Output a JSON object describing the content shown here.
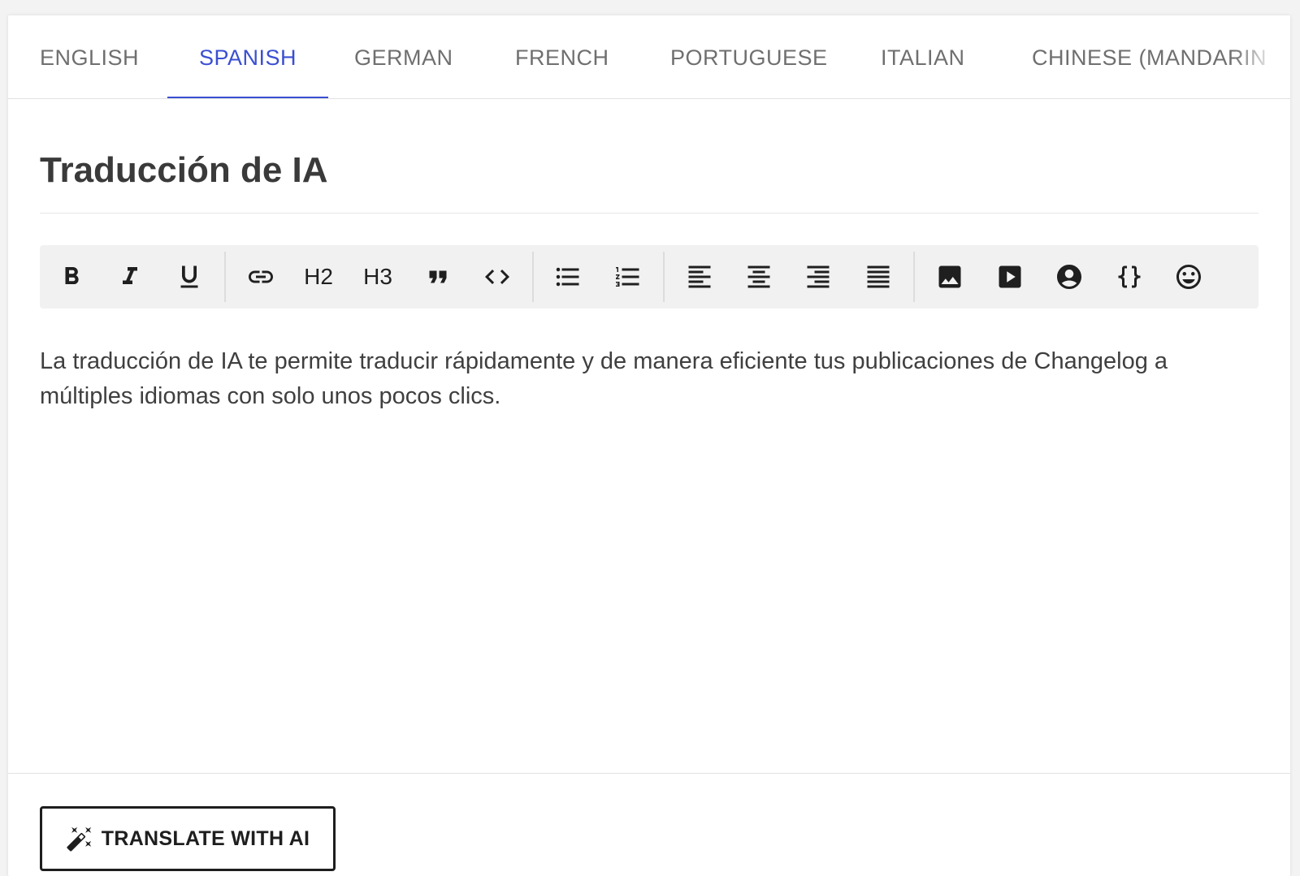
{
  "tabs": [
    {
      "label": "ENGLISH"
    },
    {
      "label": "SPANISH"
    },
    {
      "label": "GERMAN"
    },
    {
      "label": "FRENCH"
    },
    {
      "label": "PORTUGUESE"
    },
    {
      "label": "ITALIAN"
    },
    {
      "label": "CHINESE (MANDARIN"
    }
  ],
  "active_tab": "SPANISH",
  "colors": {
    "accent": "#3b4fd1",
    "toolbar_bg": "#f1f1f1",
    "text": "#3f3f3f"
  },
  "editor": {
    "title": "Traducción de IA",
    "body": "La traducción de IA te permite traducir rápidamente y de manera eficiente tus publicaciones de Changelog a múltiples idiomas con solo unos pocos clics."
  },
  "toolbar": {
    "h2_label": "H2",
    "h3_label": "H3",
    "icons": [
      "bold-icon",
      "italic-icon",
      "underline-icon",
      "link-icon",
      "quote-icon",
      "code-icon",
      "bullet-list-icon",
      "numbered-list-icon",
      "align-left-icon",
      "align-center-icon",
      "align-right-icon",
      "align-justify-icon",
      "image-icon",
      "video-icon",
      "user-mention-icon",
      "code-block-icon",
      "emoji-icon"
    ]
  },
  "footer": {
    "translate_label": "TRANSLATE WITH AI",
    "translate_icon": "magic-wand-icon"
  }
}
